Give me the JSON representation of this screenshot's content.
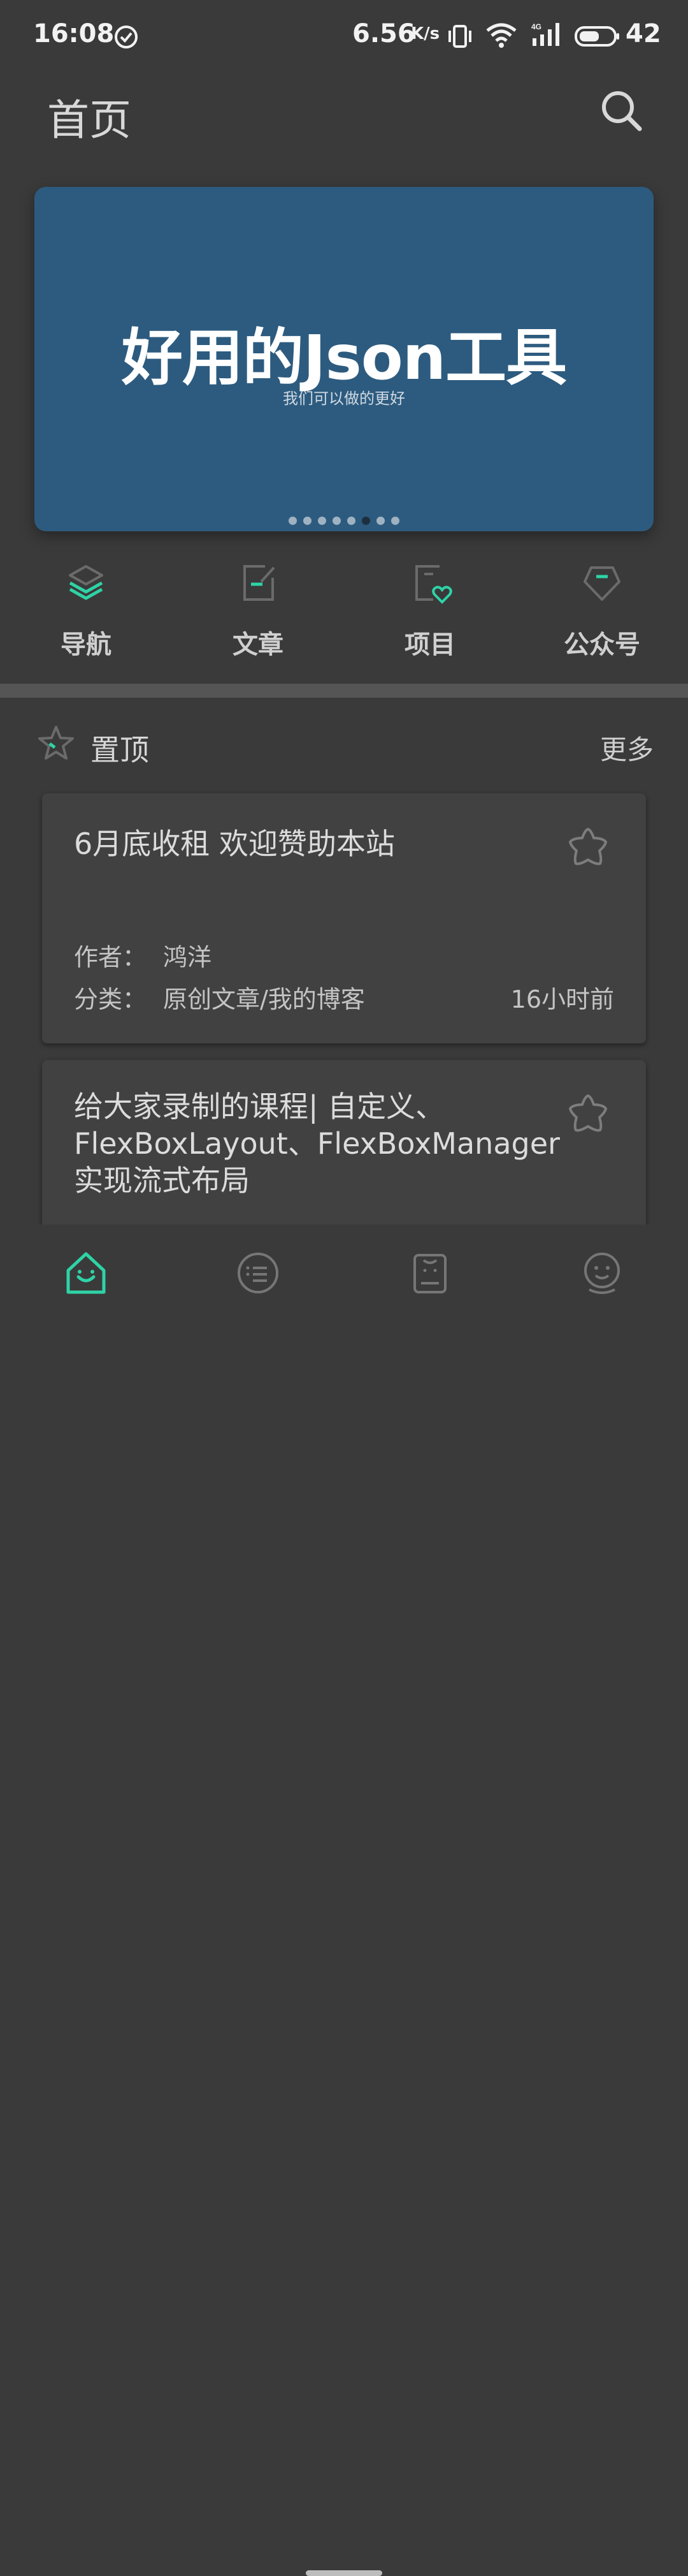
{
  "status_bar": {
    "time": "16:08",
    "net_speed": "6.56",
    "net_speed_unit": "K/s",
    "battery_level": "42",
    "icons": [
      "check-circle-icon",
      "vibrate-icon",
      "wifi-icon",
      "signal-4g-icon",
      "battery-icon"
    ]
  },
  "header": {
    "title": "首页",
    "search_icon": "search-icon"
  },
  "banner": {
    "title": "好用的Json工具",
    "subtitle": "我们可以做的更好",
    "page_count": 8,
    "active_page": 6
  },
  "quick_nav": [
    {
      "label": "导航",
      "icon": "layers-icon"
    },
    {
      "label": "文章",
      "icon": "article-edit-icon"
    },
    {
      "label": "项目",
      "icon": "project-heart-icon"
    },
    {
      "label": "公众号",
      "icon": "diamond-icon"
    }
  ],
  "pinned": {
    "title": "置顶",
    "more_label": "更多",
    "articles": [
      {
        "title": "6月底收租 欢迎赞助本站",
        "author_label": "作者：",
        "author": "鸿洋",
        "category_label": "分类：",
        "category": "原创文章/我的博客",
        "time": "16小时前"
      },
      {
        "title": "给大家录制的课程| 自定义、FlexBoxLayout、FlexBoxManager实现流式布局"
      }
    ]
  },
  "bottom_nav": [
    {
      "icon": "home-icon",
      "active": true
    },
    {
      "icon": "list-face-icon",
      "active": false
    },
    {
      "icon": "clipboard-face-icon",
      "active": false
    },
    {
      "icon": "profile-face-icon",
      "active": false
    }
  ],
  "colors": {
    "background": "#3a3a3a",
    "accent": "#2ed3a6",
    "banner": "#2d5b7f",
    "card": "#414141"
  }
}
